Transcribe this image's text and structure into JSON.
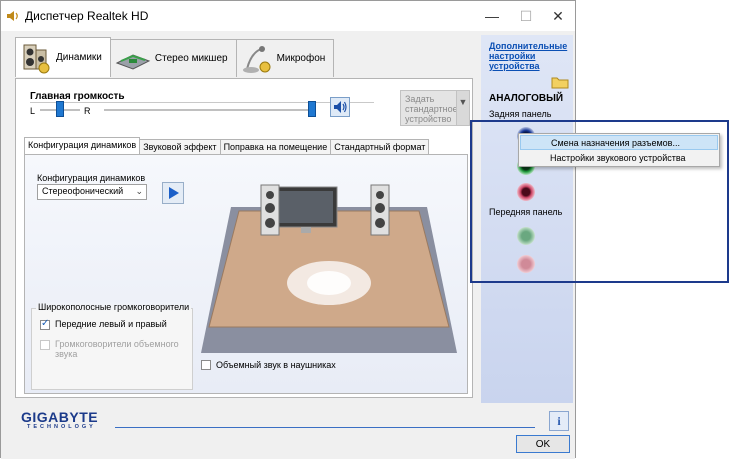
{
  "window": {
    "title": "Диспетчер Realtek HD",
    "minimize": "—",
    "maximize": "☐",
    "close": "✕"
  },
  "top_tabs": [
    {
      "label": "Динамики",
      "active": true
    },
    {
      "label": "Стерео микшер",
      "active": false
    },
    {
      "label": "Микрофон",
      "active": false
    }
  ],
  "volume": {
    "label": "Главная громкость",
    "left": "L",
    "right": "R",
    "balance": 0.5,
    "level": 1.0
  },
  "preset": {
    "label": "Задать стандартное устройство"
  },
  "sub_tabs": [
    {
      "label": "Конфигурация динамиков",
      "active": true
    },
    {
      "label": "Звуковой эффект",
      "active": false
    },
    {
      "label": "Поправка на помещение",
      "active": false
    },
    {
      "label": "Стандартный формат",
      "active": false
    }
  ],
  "speaker_config": {
    "label": "Конфигурация динамиков",
    "selected": "Стереофонический"
  },
  "wide_range": {
    "legend": "Широкополосные громкоговорители",
    "front": "Передние левый и правый",
    "surround": "Громкоговорители объемного звука"
  },
  "headphone_label": "Объемный звук в наушниках",
  "right_panel": {
    "advanced_link": "Дополнительные настройки устройства",
    "analog": "АНАЛОГОВЫЙ",
    "back_panel": "Задняя панель",
    "front_panel": "Передняя панель"
  },
  "context_menu": {
    "items": [
      "Смена назначения разъемов...",
      "Настройки звукового устройства"
    ]
  },
  "branding": {
    "logo": "GIGABYTE",
    "logo_sub": "TECHNOLOGY"
  },
  "ok_label": "OK",
  "info_label": "i",
  "colors": {
    "accent": "#1f78d1",
    "highlight_border": "#1d3a8c",
    "jack_blue": "#1a3a9a",
    "jack_green": "#1e9a3a",
    "jack_pink": "#d04a6a"
  }
}
